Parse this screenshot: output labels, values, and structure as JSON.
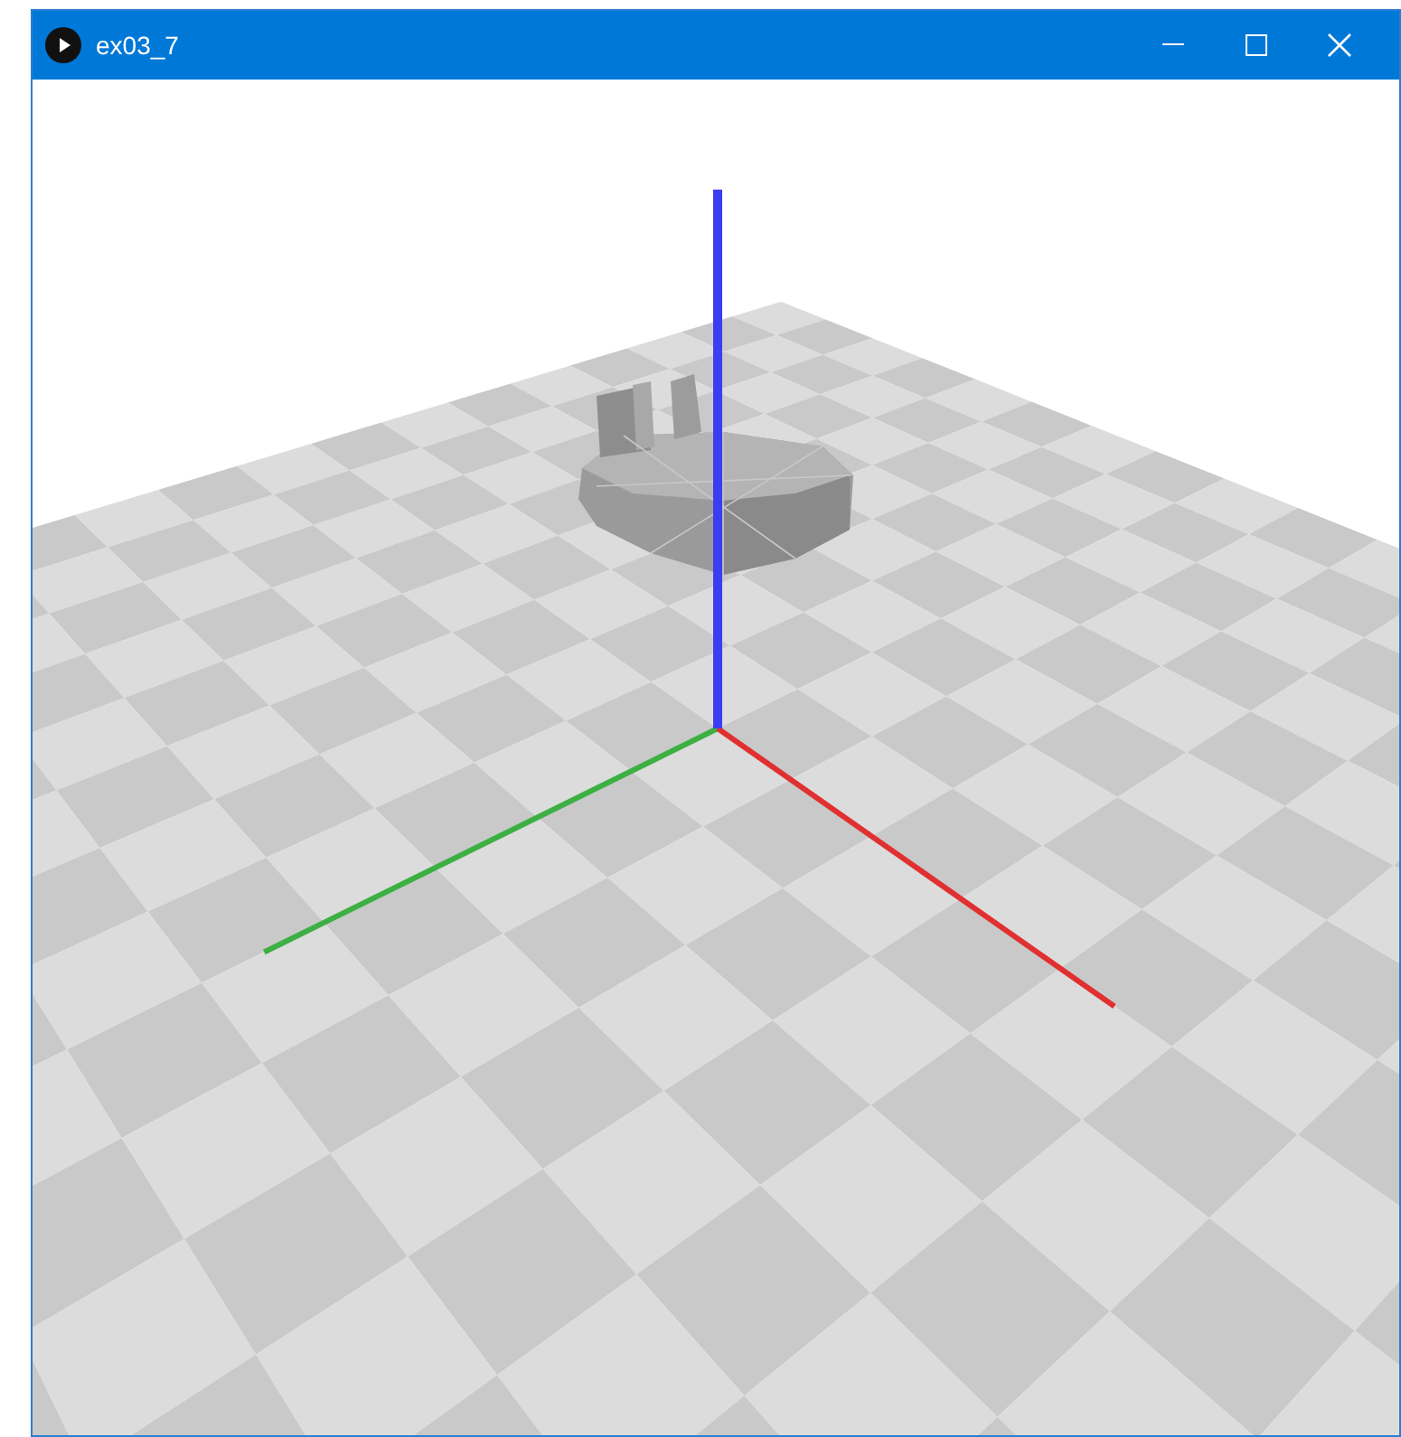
{
  "window": {
    "title": "ex03_7"
  }
}
